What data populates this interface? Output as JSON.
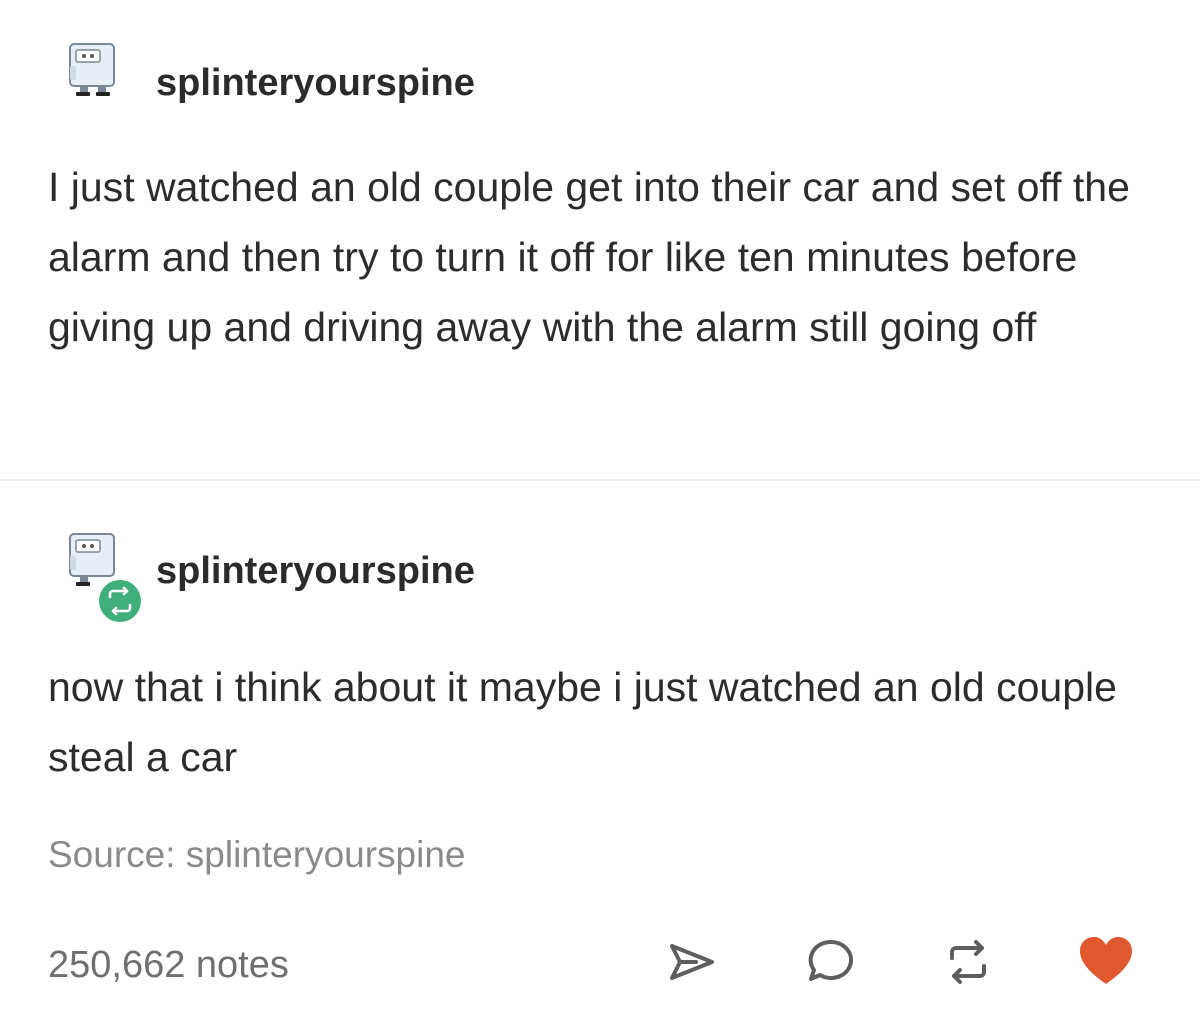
{
  "original_post": {
    "username": "splinteryourspine",
    "avatar_icon": "cartoon-computer-icon",
    "text": "I just watched an old couple get into their car and set off the alarm and then try to turn it off for like ten minutes before giving up and driving away with the alarm still going off"
  },
  "reblog_post": {
    "username": "splinteryourspine",
    "avatar_icon": "cartoon-computer-icon",
    "badge_icon": "reblog-icon",
    "badge_color": "#3fae7b",
    "text": "now that i think about it maybe i just watched an old couple steal a car"
  },
  "source": {
    "label": "Source: splinteryourspine"
  },
  "footer": {
    "notes": "250,662 notes",
    "actions": [
      {
        "icon": "share-icon"
      },
      {
        "icon": "reply-icon"
      },
      {
        "icon": "reblog-icon"
      },
      {
        "icon": "heart-icon",
        "color": "#e0592e"
      }
    ]
  }
}
